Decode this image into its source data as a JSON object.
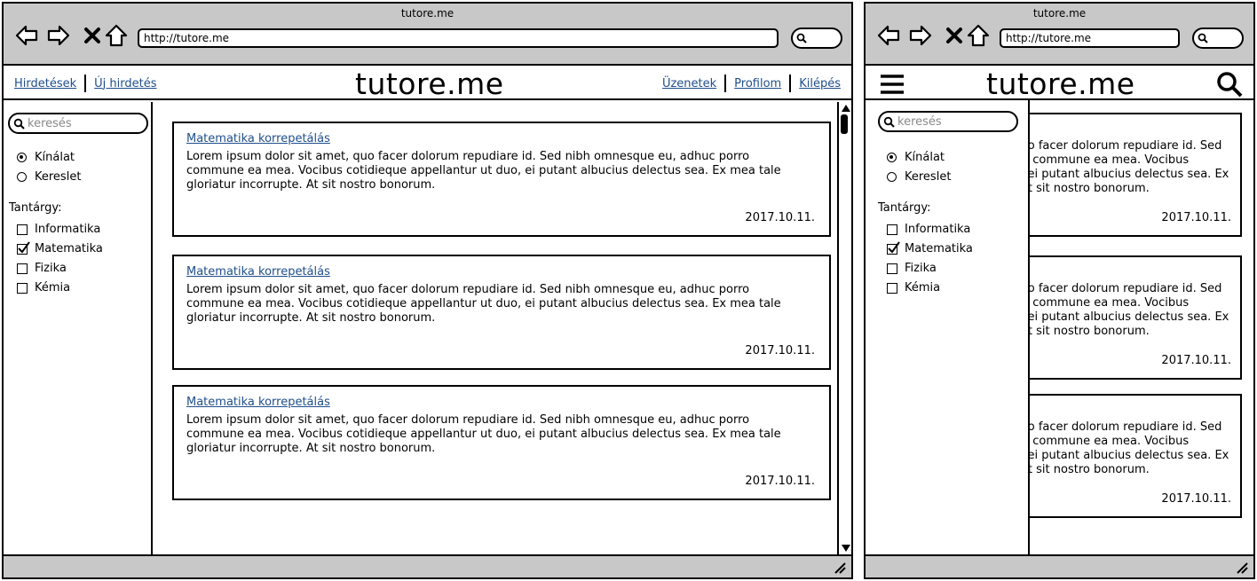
{
  "browser": {
    "title": "tutore.me",
    "url": "http://tutore.me"
  },
  "site": {
    "logo": "tutore.me",
    "nav_left": [
      "Hirdetések",
      "Új hirdetés"
    ],
    "nav_right": [
      "Üzenetek",
      "Profilom",
      "Kilépés"
    ]
  },
  "sidebar": {
    "search_placeholder": "keresés",
    "type_options": [
      {
        "label": "Kínálat",
        "selected": true
      },
      {
        "label": "Kereslet",
        "selected": false
      }
    ],
    "subject_label": "Tantárgy:",
    "subjects": [
      {
        "label": "Informatika",
        "checked": false
      },
      {
        "label": "Matematika",
        "checked": true
      },
      {
        "label": "Fizika",
        "checked": false
      },
      {
        "label": "Kémia",
        "checked": false
      }
    ]
  },
  "listings": [
    {
      "title": "Matematika korrepetálás",
      "body": "Lorem ipsum dolor sit amet, quo facer dolorum repudiare id. Sed nibh omnesque eu, adhuc porro commune ea mea. Vocibus cotidieque appellantur ut duo, ei putant albucius delectus sea. Ex mea tale gloriatur incorrupte. At sit nostro bonorum.",
      "date": "2017.10.11."
    },
    {
      "title": "Matematika korrepetálás",
      "body": "Lorem ipsum dolor sit amet, quo facer dolorum repudiare id. Sed nibh omnesque eu, adhuc porro commune ea mea. Vocibus cotidieque appellantur ut duo, ei putant albucius delectus sea. Ex mea tale gloriatur incorrupte. At sit nostro bonorum.",
      "date": "2017.10.11."
    },
    {
      "title": "Matematika korrepetálás",
      "body": "Lorem ipsum dolor sit amet, quo facer dolorum repudiare id. Sed nibh omnesque eu, adhuc porro commune ea mea. Vocibus cotidieque appellantur ut duo, ei putant albucius delectus sea. Ex mea tale gloriatur incorrupte. At sit nostro bonorum.",
      "date": "2017.10.11."
    }
  ],
  "mobile_listings": [
    {
      "lines": [
        ", quo facer dolorum repudiare id. Sed",
        "orro commune ea mea. Vocibus",
        "uo, ei putant albucius delectus sea. Ex",
        "e. At sit nostro bonorum."
      ],
      "date": "2017.10.11."
    },
    {
      "lines": [
        ", quo facer dolorum repudiare id. Sed",
        "orro commune ea mea. Vocibus",
        "uo, ei putant albucius delectus sea. Ex",
        "e. At sit nostro bonorum."
      ],
      "date": "2017.10.11."
    },
    {
      "lines": [
        ", quo facer dolorum repudiare id. Sed",
        "orro commune ea mea. Vocibus",
        "uo, ei putant albucius delectus sea. Ex",
        "e. At sit nostro bonorum."
      ],
      "date": "2017.10.11."
    }
  ],
  "icons": {
    "back": "arrow-left-icon",
    "forward": "arrow-right-icon",
    "stop": "close-icon",
    "home": "home-icon",
    "search": "search-icon",
    "menu": "hamburger-menu-icon",
    "checkmark": "check-icon",
    "resize": "resize-grip-icon"
  },
  "colors": {
    "chrome": "#c8c8c8",
    "link": "#1f4e8c"
  }
}
